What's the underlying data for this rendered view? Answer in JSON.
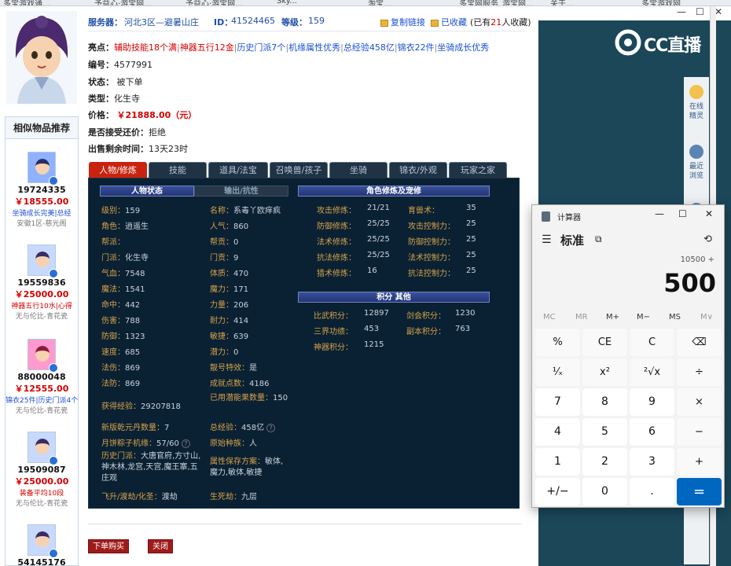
{
  "browser": {
    "tabs": [
      "多宝游戏通...",
      "予益心·游宝网...",
      "予益心·游宝网...",
      "Sky...",
      "淘宝...",
      "多宝网服务_游宝网...",
      "关于...",
      "多宝游戏网"
    ]
  },
  "header": {
    "server_label": "服务器：",
    "server_value": "河北3区—避暑山庄",
    "id_label": "ID：",
    "id_value": "41524465",
    "level_label": "等级：",
    "level_value": "159",
    "copy_link": "复制链接",
    "favorited": "已收藏",
    "fav_note_pre": "(已有",
    "fav_count": "21",
    "fav_note_post": "人收藏)"
  },
  "item": {
    "highlights_label": "亮点：",
    "highlights": [
      "辅助技能18个满",
      "神器五行12金",
      "历史门派7个",
      "机缘属性优秀",
      "总经验458亿",
      "锦衣22件",
      "坐骑成长优秀"
    ],
    "number_label": "编号：",
    "number_value": "4577991",
    "status_label": "状态：",
    "status_value": "被下单",
    "type_label": "类型：",
    "type_value": "化生寺",
    "price_label": "价格：",
    "price_value": "￥21888.00（元）",
    "counter_label": "是否接受还价：",
    "counter_value": "拒绝",
    "remain_label": "出售剩余时间：",
    "remain_value": "13天23时"
  },
  "tabs": [
    "人物/修炼",
    "技能",
    "道具/法宝",
    "召唤兽/孩子",
    "坐骑",
    "锦衣/外观",
    "玩家之家"
  ],
  "panel": {
    "char_header": "人物状态",
    "anti_header": "输出/抗性",
    "cult_header": "角色修炼及宠修",
    "score_header": "积分  其他",
    "left_col": [
      [
        "级别：",
        "159"
      ],
      [
        "角色：",
        "逍遥生"
      ],
      [
        "帮派：",
        ""
      ],
      [
        "门派：",
        "化生寺"
      ],
      [
        "气血：",
        "7548"
      ],
      [
        "魔法：",
        "1541"
      ],
      [
        "命中：",
        "442"
      ],
      [
        "伤害：",
        "788"
      ],
      [
        "防御：",
        "1323"
      ],
      [
        "速度：",
        "685"
      ],
      [
        "法伤：",
        "869"
      ],
      [
        "法防：",
        "869"
      ]
    ],
    "mid_col": [
      [
        "名称：",
        "系毒丫欧痒疯"
      ],
      [
        "人气：",
        "860"
      ],
      [
        "帮贡：",
        "0"
      ],
      [
        "门贡：",
        "9"
      ],
      [
        "体质：",
        "470"
      ],
      [
        "魔力：",
        "171"
      ],
      [
        "力量：",
        "206"
      ],
      [
        "耐力：",
        "414"
      ],
      [
        "敏捷：",
        "639"
      ],
      [
        "潜力：",
        "0"
      ],
      [
        "靓号特效：",
        "是"
      ],
      [
        "成就点数：",
        "4186"
      ]
    ],
    "exp_label": "获得经验：",
    "exp_value": "29207818",
    "potential_label": "已用潜能果数量：",
    "potential_value": "150",
    "qiankun_label": "新版乾元丹数量：",
    "qiankun_value": "7",
    "total_exp_label": "总经验：",
    "total_exp_value": "458亿",
    "yuebing_label": "月饼粽子机缘：",
    "yuebing_value": "57/60",
    "race_label": "原始种族：",
    "race_value": "人",
    "history_label": "历史门派：",
    "history_value": "大唐官府,方寸山,神木林,龙宫,天宫,魔王寨,五庄观",
    "attr_label": "属性保存方案：",
    "attr_value": "敏体,魔力,敏体,敏捷",
    "feisheng_label": "飞升/渡劫/化圣：",
    "feisheng_value": "渡劫",
    "shengsi_label": "生死劫：",
    "shengsi_value": "九层",
    "cult_rows": [
      [
        "攻击修炼：",
        "21/21",
        "育兽术：",
        "35"
      ],
      [
        "防御修炼：",
        "25/25",
        "攻击控制力：",
        "25"
      ],
      [
        "法术修炼：",
        "25/25",
        "防御控制力：",
        "25"
      ],
      [
        "抗法修炼：",
        "25/25",
        "法术控制力：",
        "25"
      ],
      [
        "猎术修炼：",
        "16",
        "抗法控制力：",
        "25"
      ]
    ],
    "score_rows": [
      [
        "比武积分：",
        "12897",
        "剑会积分：",
        "1230"
      ],
      [
        "三界功绩：",
        "453",
        "副本积分：",
        "763"
      ],
      [
        "神器积分：",
        "1215",
        "",
        ""
      ]
    ]
  },
  "actions": {
    "buy": "下单购买",
    "close": "关闭"
  },
  "similar": {
    "title": "相似物品推荐",
    "items": [
      {
        "id": "19724335",
        "price": "￥18555.00",
        "desc": "坐骑成长完美|总经",
        "desc_color": "blue",
        "server": "安徽1区-慈光阁"
      },
      {
        "id": "19559836",
        "price": "￥25000.00",
        "desc": "神器五行10水|心得",
        "desc_color": "red",
        "server": "无与伦比-青花瓷"
      },
      {
        "id": "88000048",
        "price": "￥12555.00",
        "desc": "锦衣25件|历史门派4个",
        "desc_color": "blue",
        "server": "无与伦比-青花瓷"
      },
      {
        "id": "19509087",
        "price": "￥25000.00",
        "desc": "装备平均10段",
        "desc_color": "red",
        "server": "无与伦比-青花瓷"
      },
      {
        "id": "54145176",
        "price": "",
        "desc": "",
        "desc_color": "red",
        "server": ""
      }
    ]
  },
  "stream": {
    "logo_text": "CC直播",
    "side_items": [
      {
        "label": "在线精灵"
      },
      {
        "label": "最近浏览"
      },
      {
        "label": "历史"
      }
    ]
  },
  "calculator": {
    "title": "计算器",
    "mode": "标准",
    "expression": "10500 +",
    "display": "500",
    "memory": [
      "MC",
      "MR",
      "M+",
      "M−",
      "MS",
      "M∨"
    ],
    "keys": [
      [
        "%",
        "CE",
        "C",
        "⌫"
      ],
      [
        "¹⁄ₓ",
        "x²",
        "²√x",
        "÷"
      ],
      [
        "7",
        "8",
        "9",
        "×"
      ],
      [
        "4",
        "5",
        "6",
        "−"
      ],
      [
        "1",
        "2",
        "3",
        "+"
      ],
      [
        "+/−",
        "0",
        ".",
        "="
      ]
    ]
  }
}
